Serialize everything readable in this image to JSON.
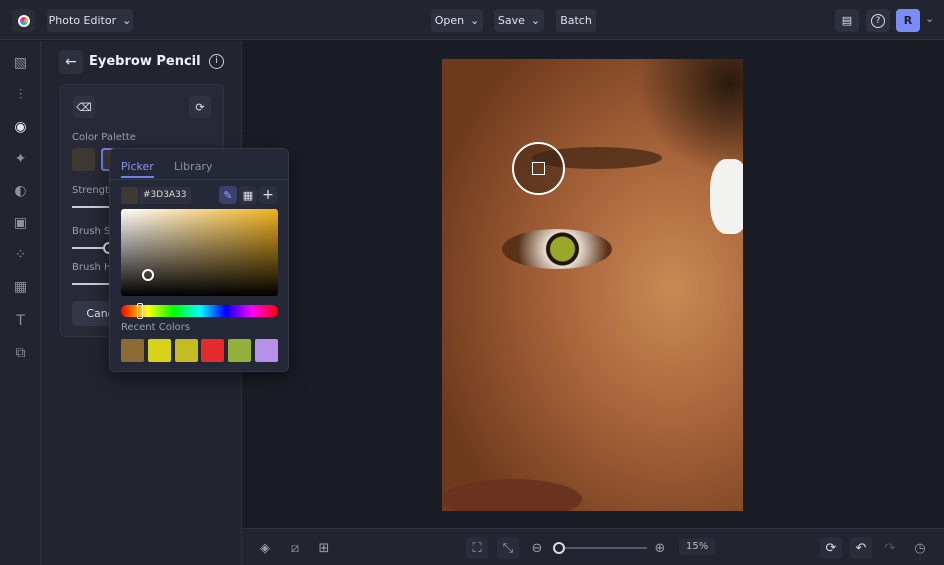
{
  "topbar": {
    "app_label": "Photo Editor",
    "open": "Open",
    "save": "Save",
    "batch": "Batch",
    "avatar": "R"
  },
  "panel": {
    "title": "Eyebrow Pencil",
    "color_palette": "Color Palette",
    "strength": "Strength",
    "brush_size": "Brush Size",
    "brush_hardness": "Brush Hardness",
    "cancel": "Cancel"
  },
  "picker": {
    "tab_picker": "Picker",
    "tab_library": "Library",
    "hex": "#3D3A33",
    "current_color": "#3D3A33",
    "hue_color": "#F2B01E",
    "recent_label": "Recent Colors",
    "recent_colors": [
      "#8C6A34",
      "#D9D318",
      "#C4BC22",
      "#E52B2B",
      "#93B03B",
      "#B990E8"
    ]
  },
  "bottom": {
    "zoom": "15%",
    "zoom_slider_fraction": 0.0
  }
}
